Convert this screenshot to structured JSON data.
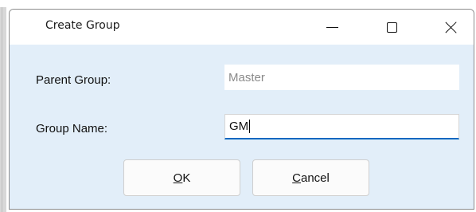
{
  "window": {
    "title": "Create Group",
    "controls": {
      "minimize": "minimize-icon",
      "maximize": "maximize-icon",
      "close": "close-icon"
    }
  },
  "form": {
    "parent_group": {
      "label": "Parent Group:",
      "value": "Master"
    },
    "group_name": {
      "label": "Group Name:",
      "value": "GM"
    }
  },
  "buttons": {
    "ok": {
      "mnemonic": "O",
      "rest": "K"
    },
    "cancel": {
      "mnemonic": "C",
      "rest": "ancel"
    }
  },
  "colors": {
    "dialog_background": "#e2eef9",
    "focus_underline": "#0067c0",
    "readonly_text": "#8a8a8a"
  }
}
